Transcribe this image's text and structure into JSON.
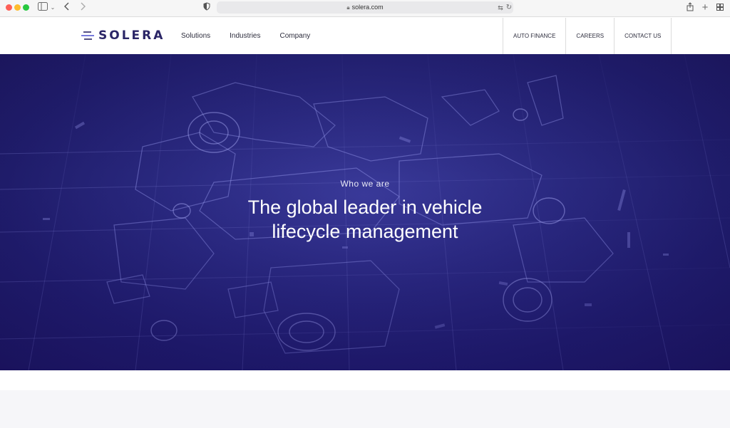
{
  "browser": {
    "url": "solera.com"
  },
  "header": {
    "logo_text": "SOLERA",
    "nav": [
      "Solutions",
      "Industries",
      "Company"
    ],
    "utility_links": [
      "AUTO FINANCE",
      "CAREERS",
      "CONTACT US"
    ]
  },
  "hero": {
    "kicker": "Who we are",
    "title": "The global leader in vehicle lifecycle management"
  },
  "colors": {
    "brand_navy": "#2a2566",
    "hero_background": "#1f1c6a",
    "logo_accent": "#4a4fd0"
  },
  "icons": {
    "sidebar": "sidebar-icon",
    "back": "chevron-left-icon",
    "forward": "chevron-right-icon",
    "shield": "shield-icon",
    "lock": "lock-icon",
    "translate": "translate-icon",
    "reload": "reload-icon",
    "share": "share-icon",
    "new_tab": "plus-icon",
    "tabs": "tab-overview-icon"
  }
}
